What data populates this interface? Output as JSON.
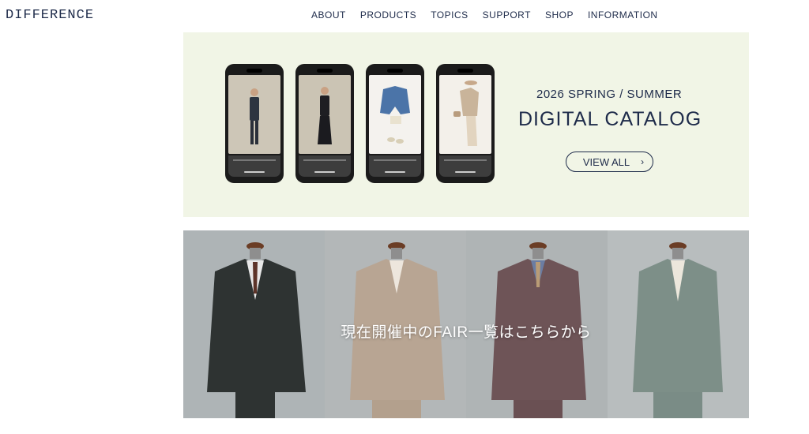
{
  "header": {
    "logo": "DIFFERENCE",
    "nav": [
      "ABOUT",
      "PRODUCTS",
      "TOPICS",
      "SUPPORT",
      "SHOP",
      "INFORMATION"
    ]
  },
  "catalog": {
    "season": "2026 SPRING / SUMMER",
    "title": "DIGITAL CATALOG",
    "button_label": "VIEW ALL",
    "button_icon": "chevron-right-icon",
    "background": "#f1f5e6"
  },
  "fair": {
    "caption": "現在開催中のFAIR一覧はこちらから",
    "suits": [
      "charcoal double-breasted suit",
      "beige double-breasted jacket",
      "burgundy three-piece suit",
      "sage green jacket"
    ]
  },
  "colors": {
    "text": "#1e2b4a",
    "catalog_bg": "#f1f5e6"
  }
}
